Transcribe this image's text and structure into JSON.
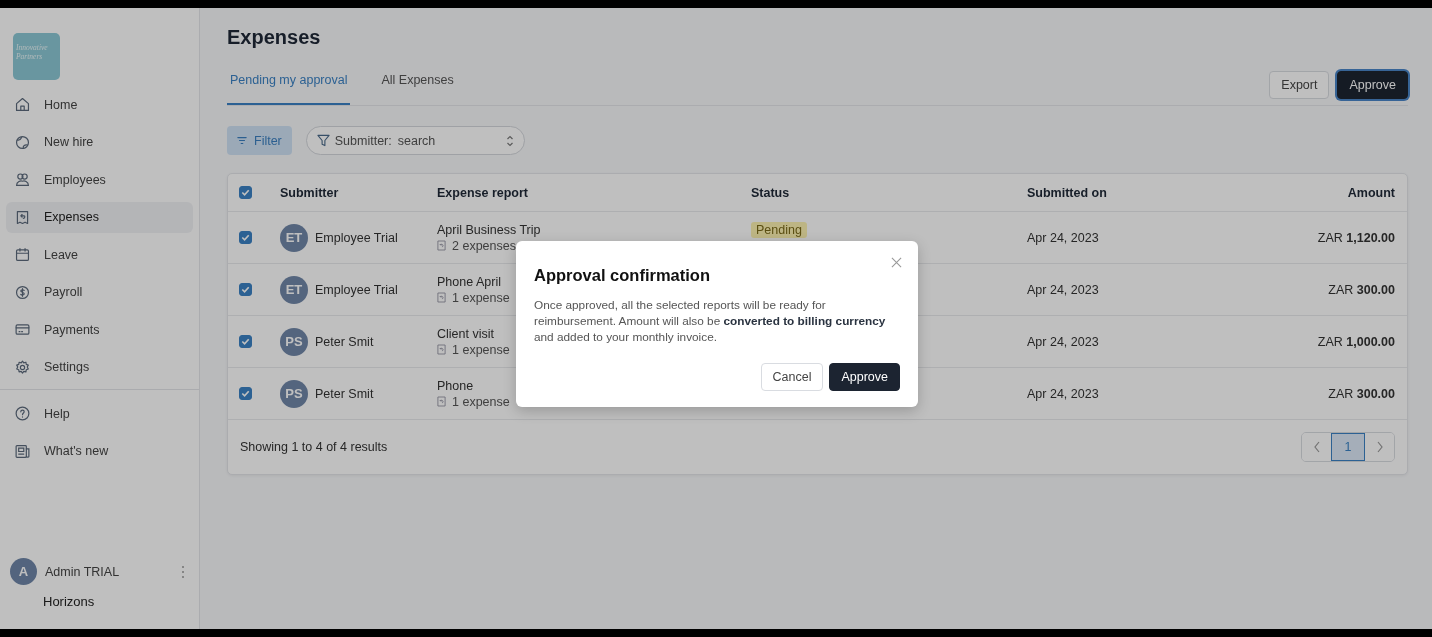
{
  "sidebar": {
    "logo": "Innovative Partners",
    "items": [
      {
        "label": "Home",
        "selected": false
      },
      {
        "label": "New hire",
        "selected": false
      },
      {
        "label": "Employees",
        "selected": false
      },
      {
        "label": "Expenses",
        "selected": true
      },
      {
        "label": "Leave",
        "selected": false
      },
      {
        "label": "Payroll",
        "selected": false
      },
      {
        "label": "Payments",
        "selected": false
      },
      {
        "label": "Settings",
        "selected": false
      }
    ],
    "footer_items": [
      {
        "label": "Help"
      },
      {
        "label": "What's new"
      }
    ],
    "user": {
      "initial": "A",
      "name": "Admin TRIAL"
    },
    "brand": "Horizons"
  },
  "page": {
    "title": "Expenses",
    "tabs": [
      {
        "label": "Pending my approval",
        "selected": true
      },
      {
        "label": "All Expenses",
        "selected": false
      }
    ],
    "actions": [
      "Export",
      "Approve"
    ],
    "filter_button": "Filter",
    "submitter_filter": {
      "label": "Submitter:",
      "placeholder": "search"
    }
  },
  "table": {
    "select_all": {
      "checked": true
    },
    "columns": [
      "Submitter",
      "Expense report",
      "Status",
      "Submitted on",
      "Amount"
    ],
    "rows": [
      {
        "checked": true,
        "initials": "ET",
        "submitter": "Employee Trial",
        "report": "April Business Trip",
        "count": "2 expenses",
        "status": "Pending",
        "submitted": "Apr 24, 2023",
        "amount": "ZAR **1,120.00**"
      },
      {
        "checked": true,
        "initials": "ET",
        "submitter": "Employee Trial",
        "report": "Phone April",
        "count": "1 expense",
        "submitted": "Apr 24, 2023",
        "amount": "ZAR **300.00**"
      },
      {
        "checked": true,
        "initials": "PS",
        "submitter": "Peter Smit",
        "report": "Client visit",
        "count": "1 expense",
        "submitted": "Apr 24, 2023",
        "amount": "ZAR **1,000.00**"
      },
      {
        "checked": true,
        "initials": "PS",
        "submitter": "Peter Smit",
        "report": "Phone",
        "count": "1 expense",
        "submitted": "Apr 24, 2023",
        "amount": "ZAR **300.00**"
      }
    ],
    "summary": "Showing 1 to 4 of 4 results",
    "pages": [
      {
        "label": "1",
        "selected": true
      }
    ]
  },
  "dialog": {
    "title": "Approval confirmation",
    "body": "Once approved, all the selected reports will be ready for reimbursement. Amount will also be **converted to billing currency** and added to your monthly invoice.",
    "buttons": [
      "Cancel",
      "Approve"
    ]
  }
}
